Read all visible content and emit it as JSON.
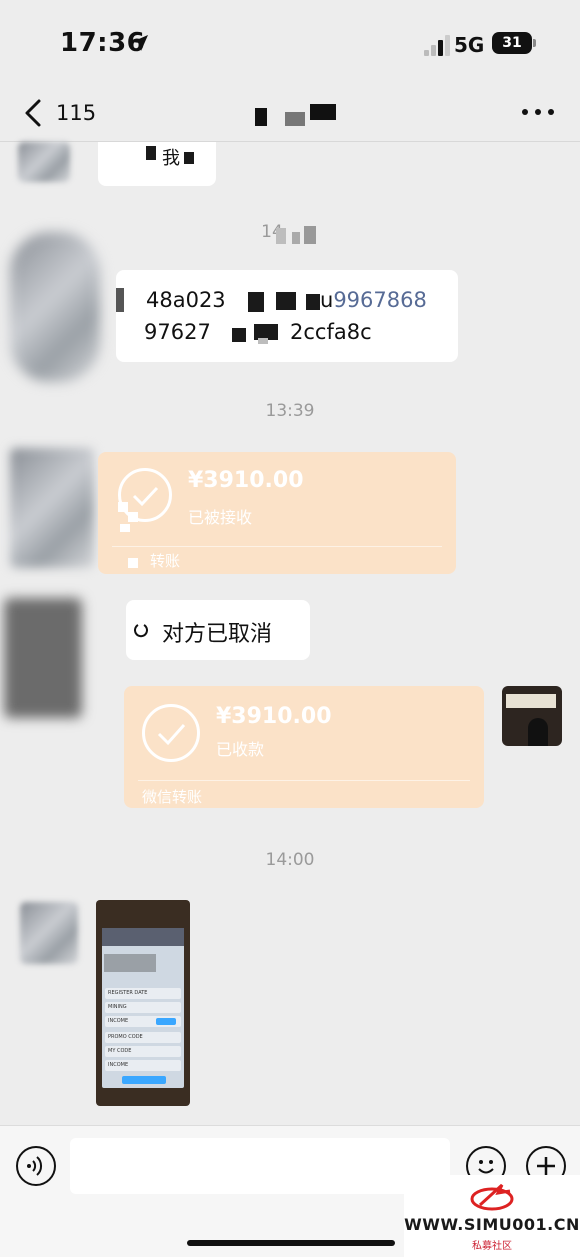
{
  "status_bar": {
    "time": "17:36",
    "network": "5G",
    "battery": "31"
  },
  "nav": {
    "back_count": "115"
  },
  "messages": {
    "first_partial_text": "我",
    "timestamp_1": "14",
    "hash_line_1_a": "48a023",
    "hash_line_1_b": "u",
    "hash_line_1_link": "9967868",
    "hash_line_2_a": "97627",
    "hash_line_2_b": "2ccfa8c",
    "timestamp_2": "13:39",
    "transfer_in": {
      "amount": "¥3910.00",
      "status": "已被接收",
      "footer": "转账"
    },
    "cancelled_text": "对方已取消",
    "transfer_out": {
      "amount": "¥3910.00",
      "status": "已收款",
      "footer": "微信转账"
    },
    "timestamp_3": "14:00",
    "shot_rows": [
      "REGISTER DATE",
      "MINING",
      "INCOME",
      "PROMO CODE",
      "MY CODE",
      "INCOME"
    ]
  },
  "watermark": {
    "text": "WWW.SIMU001.CN",
    "sub": "私募社区"
  },
  "colors": {
    "transfer_bg": "#fbe2c8",
    "link": "#576b95",
    "background": "#ededed"
  }
}
